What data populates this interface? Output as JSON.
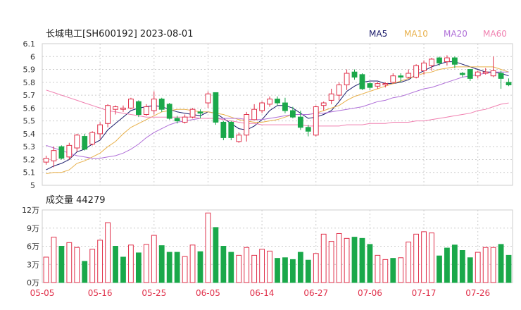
{
  "header": {
    "title": "长城电工[SH600192] 2023-08-01",
    "legend": [
      {
        "label": "MA5",
        "color": "#1a1a6a"
      },
      {
        "label": "MA10",
        "color": "#e8b04a"
      },
      {
        "label": "MA20",
        "color": "#b070d8"
      },
      {
        "label": "MA60",
        "color": "#f080b0"
      }
    ]
  },
  "volume_header": {
    "label": "成交量 44279"
  },
  "colors": {
    "up": "#e0304a",
    "down": "#1aa84a",
    "grid": "#cccccc",
    "axis_text": "#333333",
    "date_text": "#e0304a"
  },
  "chart_data": [
    {
      "type": "candlestick",
      "title": "长城电工[SH600192] 2023-08-01",
      "ylim": [
        5.0,
        6.1
      ],
      "y_ticks": [
        "6.1",
        "6",
        "5.9",
        "5.8",
        "5.7",
        "5.6",
        "5.5",
        "5.4",
        "5.3",
        "5.2",
        "5.1",
        "5"
      ],
      "x_ticks": [
        "05-05",
        "05-16",
        "05-25",
        "06-05",
        "06-14",
        "06-27",
        "07-06",
        "07-17",
        "07-26"
      ],
      "x_tick_index": [
        0,
        7,
        14,
        21,
        28,
        35,
        42,
        49,
        56
      ],
      "candles": [
        [
          5.18,
          5.21,
          5.16,
          5.23
        ],
        [
          5.19,
          5.27,
          5.14,
          5.3
        ],
        [
          5.3,
          5.21,
          5.2,
          5.31
        ],
        [
          5.22,
          5.31,
          5.2,
          5.33
        ],
        [
          5.29,
          5.39,
          5.26,
          5.4
        ],
        [
          5.38,
          5.28,
          5.27,
          5.4
        ],
        [
          5.32,
          5.41,
          5.31,
          5.42
        ],
        [
          5.4,
          5.47,
          5.36,
          5.49
        ],
        [
          5.48,
          5.62,
          5.45,
          5.63
        ],
        [
          5.59,
          5.61,
          5.55,
          5.62
        ],
        [
          5.59,
          5.6,
          5.57,
          5.62
        ],
        [
          5.6,
          5.67,
          5.59,
          5.68
        ],
        [
          5.65,
          5.55,
          5.53,
          5.66
        ],
        [
          5.55,
          5.61,
          5.54,
          5.63
        ],
        [
          5.58,
          5.67,
          5.55,
          5.73
        ],
        [
          5.67,
          5.59,
          5.57,
          5.68
        ],
        [
          5.63,
          5.52,
          5.51,
          5.64
        ],
        [
          5.52,
          5.5,
          5.48,
          5.54
        ],
        [
          5.49,
          5.53,
          5.48,
          5.55
        ],
        [
          5.53,
          5.59,
          5.52,
          5.6
        ],
        [
          5.57,
          5.56,
          5.52,
          5.59
        ],
        [
          5.64,
          5.71,
          5.6,
          5.73
        ],
        [
          5.72,
          5.49,
          5.47,
          5.72
        ],
        [
          5.49,
          5.37,
          5.35,
          5.5
        ],
        [
          5.49,
          5.37,
          5.35,
          5.5
        ],
        [
          5.34,
          5.39,
          5.33,
          5.41
        ],
        [
          5.39,
          5.55,
          5.34,
          5.57
        ],
        [
          5.51,
          5.59,
          5.51,
          5.63
        ],
        [
          5.58,
          5.64,
          5.56,
          5.65
        ],
        [
          5.63,
          5.67,
          5.61,
          5.69
        ],
        [
          5.67,
          5.64,
          5.62,
          5.69
        ],
        [
          5.64,
          5.58,
          5.56,
          5.68
        ],
        [
          5.58,
          5.53,
          5.52,
          5.61
        ],
        [
          5.53,
          5.45,
          5.43,
          5.58
        ],
        [
          5.45,
          5.42,
          5.38,
          5.47
        ],
        [
          5.39,
          5.61,
          5.38,
          5.62
        ],
        [
          5.62,
          5.64,
          5.58,
          5.65
        ],
        [
          5.66,
          5.71,
          5.63,
          5.75
        ],
        [
          5.7,
          5.78,
          5.66,
          5.8
        ],
        [
          5.78,
          5.87,
          5.74,
          5.9
        ],
        [
          5.88,
          5.84,
          5.82,
          5.9
        ],
        [
          5.86,
          5.75,
          5.74,
          5.87
        ],
        [
          5.79,
          5.76,
          5.74,
          5.8
        ],
        [
          5.77,
          5.79,
          5.75,
          5.8
        ],
        [
          5.78,
          5.79,
          5.76,
          5.8
        ],
        [
          5.8,
          5.85,
          5.79,
          5.87
        ],
        [
          5.85,
          5.84,
          5.8,
          5.87
        ],
        [
          5.84,
          5.87,
          5.83,
          5.9
        ],
        [
          5.84,
          5.93,
          5.83,
          5.94
        ],
        [
          5.89,
          5.95,
          5.86,
          5.97
        ],
        [
          5.93,
          5.98,
          5.89,
          5.99
        ],
        [
          5.99,
          5.95,
          5.93,
          6.0
        ],
        [
          5.96,
          5.99,
          5.93,
          6.01
        ],
        [
          5.99,
          5.94,
          5.91,
          6.0
        ],
        [
          5.87,
          5.86,
          5.84,
          5.88
        ],
        [
          5.9,
          5.83,
          5.81,
          5.9
        ],
        [
          5.85,
          5.88,
          5.83,
          5.89
        ],
        [
          5.87,
          5.88,
          5.86,
          5.91
        ],
        [
          5.85,
          5.89,
          5.84,
          6.0
        ],
        [
          5.87,
          5.83,
          5.75,
          5.89
        ],
        [
          5.8,
          5.78,
          5.77,
          5.83
        ]
      ],
      "series": [
        {
          "name": "MA5",
          "color": "#1a1a6a",
          "values": [
            5.12,
            5.15,
            5.17,
            5.2,
            5.26,
            5.28,
            5.32,
            5.35,
            5.43,
            5.48,
            5.53,
            5.58,
            5.6,
            5.61,
            5.62,
            5.61,
            5.59,
            5.57,
            5.56,
            5.55,
            5.54,
            5.57,
            5.56,
            5.52,
            5.48,
            5.44,
            5.43,
            5.46,
            5.51,
            5.58,
            5.62,
            5.62,
            5.6,
            5.56,
            5.52,
            5.53,
            5.55,
            5.58,
            5.65,
            5.73,
            5.77,
            5.8,
            5.81,
            5.81,
            5.79,
            5.79,
            5.8,
            5.82,
            5.86,
            5.89,
            5.92,
            5.94,
            5.96,
            5.96,
            5.94,
            5.92,
            5.9,
            5.88,
            5.88,
            5.87,
            5.85
          ]
        },
        {
          "name": "MA10",
          "color": "#e8b04a",
          "values": [
            5.09,
            5.1,
            5.1,
            5.12,
            5.17,
            5.19,
            5.22,
            5.25,
            5.3,
            5.34,
            5.4,
            5.45,
            5.48,
            5.51,
            5.54,
            5.57,
            5.58,
            5.59,
            5.59,
            5.58,
            5.57,
            5.57,
            5.56,
            5.55,
            5.53,
            5.51,
            5.5,
            5.49,
            5.49,
            5.5,
            5.51,
            5.53,
            5.55,
            5.55,
            5.55,
            5.56,
            5.58,
            5.6,
            5.62,
            5.66,
            5.69,
            5.71,
            5.73,
            5.75,
            5.77,
            5.79,
            5.81,
            5.83,
            5.85,
            5.87,
            5.88,
            5.9,
            5.91,
            5.92,
            5.92,
            5.92,
            5.92,
            5.92,
            5.92,
            5.9,
            5.88
          ]
        },
        {
          "name": "MA20",
          "color": "#b070d8",
          "values": [
            5.31,
            5.29,
            5.27,
            5.25,
            5.23,
            5.22,
            5.21,
            5.21,
            5.22,
            5.23,
            5.25,
            5.28,
            5.32,
            5.37,
            5.41,
            5.44,
            5.47,
            5.49,
            5.5,
            5.51,
            5.52,
            5.52,
            5.52,
            5.52,
            5.52,
            5.52,
            5.51,
            5.51,
            5.51,
            5.52,
            5.53,
            5.54,
            5.55,
            5.55,
            5.55,
            5.56,
            5.56,
            5.57,
            5.58,
            5.59,
            5.6,
            5.61,
            5.63,
            5.65,
            5.66,
            5.68,
            5.69,
            5.71,
            5.73,
            5.75,
            5.76,
            5.78,
            5.8,
            5.82,
            5.84,
            5.85,
            5.86,
            5.87,
            5.88,
            5.88,
            5.88
          ]
        },
        {
          "name": "MA60",
          "color": "#f080b0",
          "values": [
            5.74,
            5.72,
            5.7,
            5.68,
            5.66,
            5.64,
            5.62,
            5.6,
            5.58,
            5.57,
            5.56,
            5.55,
            5.54,
            5.53,
            5.53,
            5.53,
            5.53,
            5.53,
            5.53,
            5.53,
            5.52,
            5.52,
            5.52,
            5.51,
            5.5,
            5.49,
            5.48,
            5.48,
            5.47,
            5.47,
            5.47,
            5.47,
            5.47,
            5.47,
            5.46,
            5.46,
            5.46,
            5.46,
            5.46,
            5.47,
            5.47,
            5.47,
            5.48,
            5.48,
            5.48,
            5.49,
            5.49,
            5.49,
            5.5,
            5.5,
            5.51,
            5.52,
            5.53,
            5.54,
            5.55,
            5.56,
            5.58,
            5.59,
            5.61,
            5.63,
            5.64
          ]
        }
      ]
    },
    {
      "type": "bar",
      "title": "成交量 44279",
      "unit_label": "万",
      "ylim": [
        0,
        12
      ],
      "y_ticks": [
        "12万",
        "9万",
        "6万",
        "3万",
        "0万"
      ],
      "values": [
        4.2,
        7.5,
        6.0,
        6.6,
        5.8,
        3.5,
        5.5,
        7.0,
        9.9,
        6.0,
        4.2,
        6.2,
        4.9,
        6.3,
        7.8,
        6.1,
        5.0,
        5.0,
        4.3,
        6.2,
        5.1,
        11.5,
        9.1,
        6.0,
        5.0,
        4.5,
        5.8,
        4.5,
        5.5,
        5.2,
        4.0,
        4.1,
        3.8,
        5.0,
        3.7,
        4.8,
        8.0,
        6.8,
        8.1,
        7.3,
        7.5,
        7.3,
        6.3,
        4.5,
        3.8,
        4.0,
        4.1,
        6.7,
        8.0,
        8.4,
        8.2,
        4.4,
        5.7,
        6.2,
        5.3,
        4.1,
        5.0,
        5.8,
        5.8,
        6.3,
        4.5
      ],
      "direction": [
        "up",
        "up",
        "down",
        "up",
        "up",
        "down",
        "up",
        "up",
        "up",
        "down",
        "down",
        "up",
        "down",
        "up",
        "up",
        "down",
        "down",
        "down",
        "up",
        "up",
        "down",
        "up",
        "down",
        "down",
        "down",
        "up",
        "up",
        "up",
        "up",
        "up",
        "down",
        "down",
        "down",
        "down",
        "down",
        "up",
        "up",
        "up",
        "up",
        "up",
        "down",
        "down",
        "down",
        "up",
        "up",
        "down",
        "up",
        "up",
        "up",
        "up",
        "up",
        "down",
        "down",
        "down",
        "down",
        "down",
        "up",
        "up",
        "up",
        "down",
        "down"
      ]
    }
  ]
}
